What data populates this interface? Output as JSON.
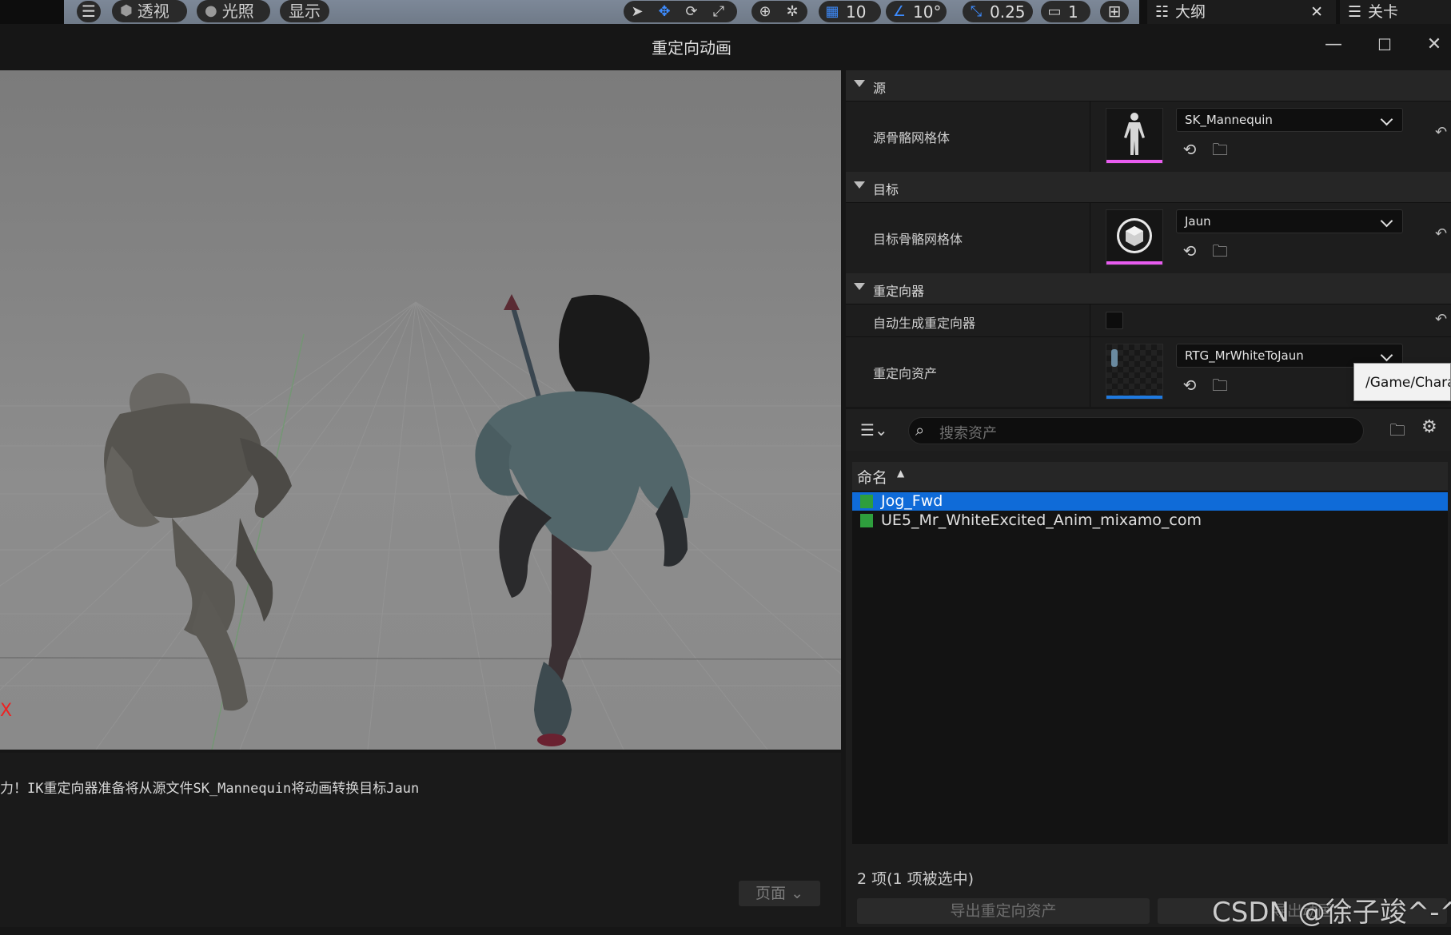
{
  "toolbar": {
    "menu_icon": "hamburger-icon",
    "perspective": "透视",
    "lighting": "光照",
    "show": "显示",
    "grid_snap_value": "10",
    "rotation_snap_value": "10°",
    "scale_snap_value": "0.25",
    "camera_speed_value": "1",
    "tab_outliner": "大纲",
    "tab_level": "关卡"
  },
  "window": {
    "title": "重定向动画",
    "minimize": "—",
    "maximize": "☐",
    "close": "✕"
  },
  "viewport": {
    "axis_label": "X"
  },
  "log": {
    "message": "力！IK重定向器准备将从源文件SK_Mannequin将动画转换目标Jaun",
    "page_button": "页面"
  },
  "details": {
    "source_section": "源",
    "source_mesh_label": "源骨骼网格体",
    "source_mesh_value": "SK_Mannequin",
    "target_section": "目标",
    "target_mesh_label": "目标骨骼网格体",
    "target_mesh_value": "Jaun",
    "retargeter_section": "重定向器",
    "auto_generate_label": "自动生成重定向器",
    "retarget_asset_label": "重定向资产",
    "retarget_asset_value": "RTG_MrWhiteToJaun",
    "tooltip": "/Game/Chara",
    "colors": {
      "skeletal_mesh_bar": "#e85cf0",
      "retargeter_bar": "#1f7ae0"
    }
  },
  "assets": {
    "search_placeholder": "搜索资产",
    "column_name": "命名",
    "rows": [
      {
        "label": "Jog_Fwd",
        "selected": true
      },
      {
        "label": "UE5_Mr_WhiteExcited_Anim_mixamo_com",
        "selected": false
      }
    ],
    "status": "2 项(1 项被选中)",
    "export_retarget_button": "导出重定向资产",
    "export_anim_button": "导出动画",
    "selection_color": "#0f6bd8"
  },
  "watermark": "CSDN @徐子竣^-^"
}
